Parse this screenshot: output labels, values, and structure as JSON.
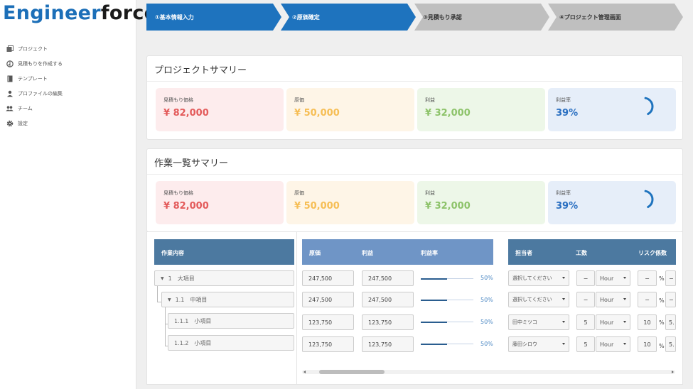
{
  "app": {
    "logo_part1": "Engineer",
    "logo_part2": "force"
  },
  "sidebar": {
    "items": [
      {
        "label": "プロジェクト",
        "icon": "folder-icon"
      },
      {
        "label": "見積もりを作成する",
        "icon": "compass-icon"
      },
      {
        "label": "テンプレート",
        "icon": "book-icon"
      },
      {
        "label": "プロファイルの編集",
        "icon": "person-icon"
      },
      {
        "label": "チーム",
        "icon": "people-icon"
      },
      {
        "label": "設定",
        "icon": "gear-icon"
      }
    ]
  },
  "steps": [
    {
      "label": "①基本情報入力",
      "state": "active"
    },
    {
      "label": "②原価確定",
      "state": "active"
    },
    {
      "label": "③見積もり承認",
      "state": "inactive"
    },
    {
      "label": "④プロジェクト管理画面",
      "state": "inactive"
    }
  ],
  "project_summary": {
    "title": "プロジェクトサマリー",
    "cards": [
      {
        "label": "見積もり価格",
        "value": "¥ 82,000"
      },
      {
        "label": "原価",
        "value": "¥ 50,000"
      },
      {
        "label": "利益",
        "value": "¥ 32,000"
      },
      {
        "label": "利益率",
        "value": "39%",
        "ratio": 0.39
      }
    ]
  },
  "task_summary": {
    "title": "作業一覧サマリー",
    "cards": [
      {
        "label": "見積もり価格",
        "value": "¥ 82,000"
      },
      {
        "label": "原価",
        "value": "¥ 50,000"
      },
      {
        "label": "利益",
        "value": "¥ 32,000"
      },
      {
        "label": "利益率",
        "value": "39%",
        "ratio": 0.39
      }
    ]
  },
  "table": {
    "headers": {
      "task": "作業内容",
      "cost": "原価",
      "profit": "利益",
      "margin": "利益率",
      "assignee": "担当者",
      "effort": "工数",
      "risk": "リスク係数"
    },
    "rows": [
      {
        "number": "1",
        "name": "大項目",
        "cost": "247,500",
        "profit": "247,500",
        "margin": "50%",
        "margin_ratio": 0.5,
        "assignee": "選択してください",
        "effort": "−",
        "unit": "Hour",
        "risk": "−",
        "risk_unit": "%",
        "extra": "−"
      },
      {
        "number": "1.1",
        "name": "中項目",
        "cost": "247,500",
        "profit": "247,500",
        "margin": "50%",
        "margin_ratio": 0.5,
        "assignee": "選択してください",
        "effort": "−",
        "unit": "Hour",
        "risk": "−",
        "risk_unit": "%",
        "extra": "−"
      },
      {
        "number": "1.1.1",
        "name": "小項目",
        "cost": "123,750",
        "profit": "123,750",
        "margin": "50%",
        "margin_ratio": 0.5,
        "assignee": "田中ミツコ",
        "effort": "5",
        "unit": "Hour",
        "risk": "10",
        "risk_unit": "%",
        "extra": "5."
      },
      {
        "number": "1.1.2",
        "name": "小項目",
        "cost": "123,750",
        "profit": "123,750",
        "margin": "50%",
        "margin_ratio": 0.5,
        "assignee": "藤田シロウ",
        "effort": "5",
        "unit": "Hour",
        "risk": "10",
        "risk_unit": "%",
        "extra": "5."
      }
    ]
  },
  "colors": {
    "step_active": "#1e73be",
    "step_inactive": "#bfbfbf",
    "header_dark": "#4c79a0",
    "header_light": "#6f95c6"
  }
}
